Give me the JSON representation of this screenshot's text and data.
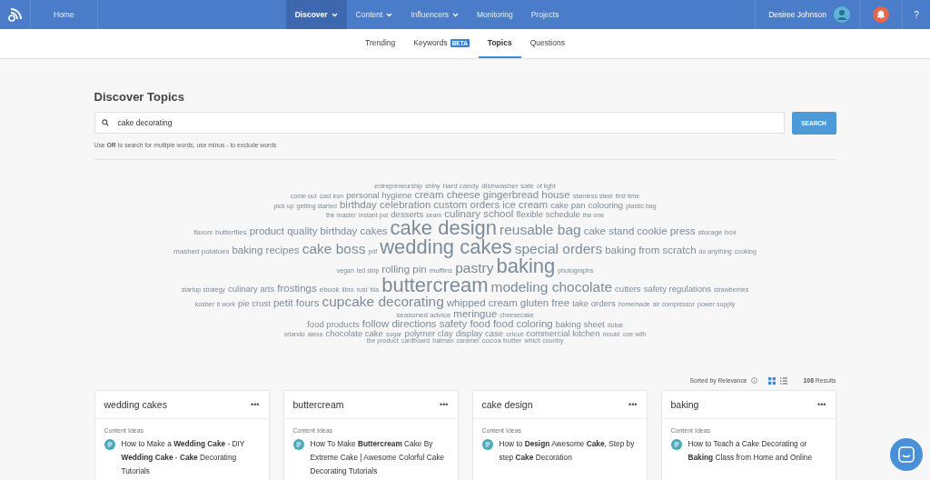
{
  "topbar": {
    "nav": [
      {
        "label": "Home",
        "selected": false,
        "dropdown": false
      },
      {
        "label": "Discover",
        "selected": true,
        "dropdown": true
      },
      {
        "label": "Content",
        "selected": false,
        "dropdown": true
      },
      {
        "label": "Influencers",
        "selected": false,
        "dropdown": true
      },
      {
        "label": "Monitoring",
        "selected": false,
        "dropdown": false
      },
      {
        "label": "Projects",
        "selected": false,
        "dropdown": false
      }
    ],
    "user": "Desiree Johnson",
    "help": "?"
  },
  "subnav": [
    {
      "label": "Trending",
      "selected": false
    },
    {
      "label": "Keywords",
      "badge": "BETA",
      "selected": false
    },
    {
      "label": "Topics",
      "selected": true
    },
    {
      "label": "Questions",
      "selected": false
    }
  ],
  "search": {
    "title": "Discover Topics",
    "value": "cake decorating",
    "button": "SEARCH",
    "hint": "Use **OR** to search for multiple words, use minus - to exclude words"
  },
  "word_cloud": {
    "lines": [
      [
        {
          "text": "entrepreneurship",
          "kind": "xs"
        },
        {
          "text": "shiny",
          "kind": "xs"
        },
        {
          "text": "hard candy",
          "kind": "s"
        },
        {
          "text": "dishwasher safe",
          "kind": "s"
        },
        {
          "text": "of light",
          "kind": "xs"
        }
      ],
      [
        {
          "text": "come out",
          "kind": "xs"
        },
        {
          "text": "cast iron",
          "kind": "xs"
        },
        {
          "text": "personal hygiene",
          "kind": "m"
        },
        {
          "text": "cream cheese",
          "kind": "l"
        },
        {
          "text": "gingerbread house",
          "kind": "l"
        },
        {
          "text": "stainless steel",
          "kind": "xs"
        },
        {
          "text": "first time",
          "kind": "xs"
        }
      ],
      [
        {
          "text": "pick up",
          "kind": "xs"
        },
        {
          "text": "getting started",
          "kind": "xs"
        },
        {
          "text": "birthday celebration",
          "kind": "l"
        },
        {
          "text": "custom orders",
          "kind": "l"
        },
        {
          "text": "ice cream",
          "kind": "l"
        },
        {
          "text": "cake pan",
          "kind": "m"
        },
        {
          "text": "colouring",
          "kind": "m"
        },
        {
          "text": "plastic bag",
          "kind": "xs"
        }
      ],
      [
        {
          "text": "the master",
          "kind": "xs"
        },
        {
          "text": "instant pot",
          "kind": "xs"
        },
        {
          "text": "desserts",
          "kind": "m"
        },
        {
          "text": "seam",
          "kind": "xs"
        },
        {
          "text": "culinary school",
          "kind": "l"
        },
        {
          "text": "flexible schedule",
          "kind": "m"
        },
        {
          "text": "the one",
          "kind": "xs"
        }
      ],
      [
        {
          "text": "flavors",
          "kind": "xs"
        },
        {
          "text": "butterflies",
          "kind": "s"
        },
        {
          "text": "product quality",
          "kind": "l"
        },
        {
          "text": "birthday cakes",
          "kind": "l"
        },
        {
          "text": "cake design",
          "kind": "xxl"
        },
        {
          "text": "reusable bag",
          "kind": "xl"
        },
        {
          "text": "cake stand",
          "kind": "l"
        },
        {
          "text": "cookie press",
          "kind": "l"
        },
        {
          "text": "storage box",
          "kind": "s"
        }
      ],
      [
        {
          "text": "mashed potatoes",
          "kind": "s"
        },
        {
          "text": "baking recipes",
          "kind": "l"
        },
        {
          "text": "cake boss",
          "kind": "xl"
        },
        {
          "text": "pdf",
          "kind": "xs"
        },
        {
          "text": "wedding cakes",
          "kind": "xxl"
        },
        {
          "text": "special orders",
          "kind": "xl"
        },
        {
          "text": "baking from scratch",
          "kind": "l"
        },
        {
          "text": "do anything",
          "kind": "xs"
        },
        {
          "text": "cooking",
          "kind": "xs"
        }
      ],
      [
        {
          "text": "vegan",
          "kind": "xs"
        },
        {
          "text": "led strip",
          "kind": "xs"
        },
        {
          "text": "rolling pin",
          "kind": "l"
        },
        {
          "text": "muffins",
          "kind": "s"
        },
        {
          "text": "pastry",
          "kind": "xl"
        },
        {
          "text": "baking",
          "kind": "xxl"
        },
        {
          "text": "photographs",
          "kind": "xs"
        }
      ],
      [
        {
          "text": "startup strategy",
          "kind": "xs"
        },
        {
          "text": "culinary arts",
          "kind": "m"
        },
        {
          "text": "frostings",
          "kind": "l"
        },
        {
          "text": "ebook",
          "kind": "s"
        },
        {
          "text": "libro",
          "kind": "xs"
        },
        {
          "text": "rust",
          "kind": "xs"
        },
        {
          "text": "fda",
          "kind": "xs"
        },
        {
          "text": "buttercream",
          "kind": "xxl"
        },
        {
          "text": "modeling chocolate",
          "kind": "xl"
        },
        {
          "text": "cutters",
          "kind": "m"
        },
        {
          "text": "safety regulations",
          "kind": "m"
        },
        {
          "text": "strawberries",
          "kind": "xs"
        }
      ],
      [
        {
          "text": "kosher",
          "kind": "xs"
        },
        {
          "text": "it work",
          "kind": "xs"
        },
        {
          "text": "pie crust",
          "kind": "m"
        },
        {
          "text": "petit fours",
          "kind": "l"
        },
        {
          "text": "cupcake decorating",
          "kind": "xl"
        },
        {
          "text": "whipped cream",
          "kind": "l"
        },
        {
          "text": "gluten free",
          "kind": "l"
        },
        {
          "text": "take orders",
          "kind": "m"
        },
        {
          "text": "homemade",
          "kind": "xs"
        },
        {
          "text": "air compressor",
          "kind": "xs"
        },
        {
          "text": "power supply",
          "kind": "xs"
        }
      ],
      [
        {
          "text": "seasoned advice",
          "kind": "s"
        },
        {
          "text": "meringue",
          "kind": "l"
        },
        {
          "text": "cheesecake",
          "kind": "xs"
        }
      ],
      [
        {
          "text": "food products",
          "kind": "m"
        },
        {
          "text": "follow directions",
          "kind": "l"
        },
        {
          "text": "safety food",
          "kind": "l"
        },
        {
          "text": "food coloring",
          "kind": "l"
        },
        {
          "text": "baking sheet",
          "kind": "m"
        },
        {
          "text": "dubai",
          "kind": "xs"
        }
      ],
      [
        {
          "text": "orlando",
          "kind": "xs"
        },
        {
          "text": "alexa",
          "kind": "xs"
        },
        {
          "text": "chocolate cake",
          "kind": "m"
        },
        {
          "text": "sugar",
          "kind": "xs"
        },
        {
          "text": "polymer clay",
          "kind": "m"
        },
        {
          "text": "display case",
          "kind": "m"
        },
        {
          "text": "cricut",
          "kind": "s"
        },
        {
          "text": "commercial kitchen",
          "kind": "m"
        },
        {
          "text": "mould",
          "kind": "xs"
        },
        {
          "text": "one with",
          "kind": "xs"
        }
      ],
      [
        {
          "text": "the product",
          "kind": "xs"
        },
        {
          "text": "cardboard",
          "kind": "xs"
        },
        {
          "text": "batman",
          "kind": "xs"
        },
        {
          "text": "caramel",
          "kind": "xs"
        },
        {
          "text": "cocoa butter",
          "kind": "s"
        },
        {
          "text": "which country",
          "kind": "xs"
        }
      ]
    ]
  },
  "results": {
    "sort": "Sorted by Relevance",
    "views": [
      {
        "kind": "grid",
        "selected": true
      },
      {
        "kind": "list",
        "selected": false
      }
    ],
    "count": "**108** Results"
  },
  "cards": [
    {
      "title": "wedding cakes",
      "menu": "•••",
      "section": "Content Ideas",
      "idea": "How to Make a **Wedding Cake** - DIY **Wedding Cake** - **Cake** Decorating Tutorials"
    },
    {
      "title": "buttercream",
      "menu": "•••",
      "section": "Content Ideas",
      "idea": "How To Make **Buttercream** Cake By Extreme Cake | Awesome Colorful Cake Decorating Tutorials"
    },
    {
      "title": "cake design",
      "menu": "•••",
      "section": "Content Ideas",
      "idea": "How to **Design** Awesome **Cake**, Step by step **Cake** Decoration"
    },
    {
      "title": "baking",
      "menu": "•••",
      "section": "Content Ideas",
      "idea": "How to Teach a Cake Decorating or **Baking** Class from Home and Online"
    }
  ]
}
